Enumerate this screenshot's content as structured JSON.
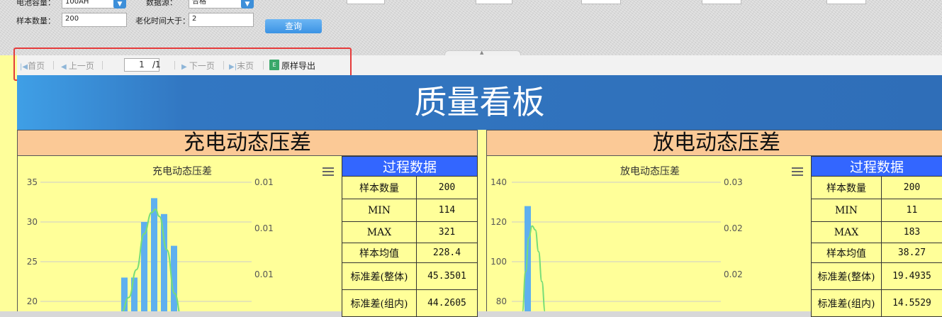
{
  "filters": {
    "capacity_label": "电池容量：",
    "capacity_value": "100AH",
    "datasource_label": "数据源：",
    "datasource_value": "合格",
    "sample_count_label": "样本数量：",
    "sample_count_value": "200",
    "aging_label": "老化时间大于：",
    "aging_value": "2",
    "query_label": "查询"
  },
  "toolbar": {
    "first": "首页",
    "prev": "上一页",
    "page_value": "1",
    "page_total": "/1",
    "next": "下一页",
    "last": "末页",
    "export": "原样导出",
    "export_icon": "E"
  },
  "report": {
    "title": "质量看板",
    "left_panel_title": "充电动态压差",
    "right_panel_title": "放电动态压差"
  },
  "tables": {
    "left": {
      "header": "过程数据",
      "rows": [
        {
          "label": "样本数量",
          "value": "200"
        },
        {
          "label": "MIN",
          "value": "114"
        },
        {
          "label": "MAX",
          "value": "321"
        },
        {
          "label": "样本均值",
          "value": "228.4"
        },
        {
          "label": "标准差(整体)",
          "value": "45.3501"
        },
        {
          "label": "标准差(组内)",
          "value": "44.2605"
        }
      ]
    },
    "right": {
      "header": "过程数据",
      "rows": [
        {
          "label": "样本数量",
          "value": "200"
        },
        {
          "label": "MIN",
          "value": "11"
        },
        {
          "label": "MAX",
          "value": "183"
        },
        {
          "label": "样本均值",
          "value": "38.27"
        },
        {
          "label": "标准差(整体)",
          "value": "19.4935"
        },
        {
          "label": "标准差(组内)",
          "value": "14.5529"
        }
      ]
    }
  },
  "chart_data": [
    {
      "type": "bar",
      "title": "充电动态压差",
      "y_ticks": [
        "35",
        "30",
        "25",
        "20"
      ],
      "y2_ticks": [
        "0.01",
        "0.01",
        "0.01"
      ],
      "ylim": [
        17.5,
        35
      ],
      "bars": [
        23,
        23,
        30,
        33,
        31,
        27
      ],
      "curve": [
        [
          18,
          18.5
        ],
        [
          20,
          20.5
        ],
        [
          22,
          24
        ],
        [
          24,
          28.5
        ],
        [
          26,
          31.2
        ],
        [
          27,
          31.6
        ],
        [
          28,
          30.7
        ],
        [
          30,
          26.5
        ],
        [
          32,
          21
        ],
        [
          34,
          17.5
        ]
      ],
      "bar_color": "#5fb0ee",
      "curve_color": "#77dd77"
    },
    {
      "type": "bar",
      "title": "放电动态压差",
      "y_ticks": [
        "140",
        "120",
        "100",
        "80"
      ],
      "y2_ticks": [
        "0.03",
        "0.02",
        "0.02"
      ],
      "ylim": [
        75,
        140
      ],
      "bars": [
        128
      ],
      "curve": [
        [
          0,
          75
        ],
        [
          1,
          95
        ],
        [
          2,
          112
        ],
        [
          3,
          118
        ],
        [
          4,
          116
        ],
        [
          5,
          105
        ],
        [
          6,
          90
        ],
        [
          7,
          75
        ]
      ],
      "bar_color": "#5fb0ee",
      "curve_color": "#77dd77"
    }
  ]
}
